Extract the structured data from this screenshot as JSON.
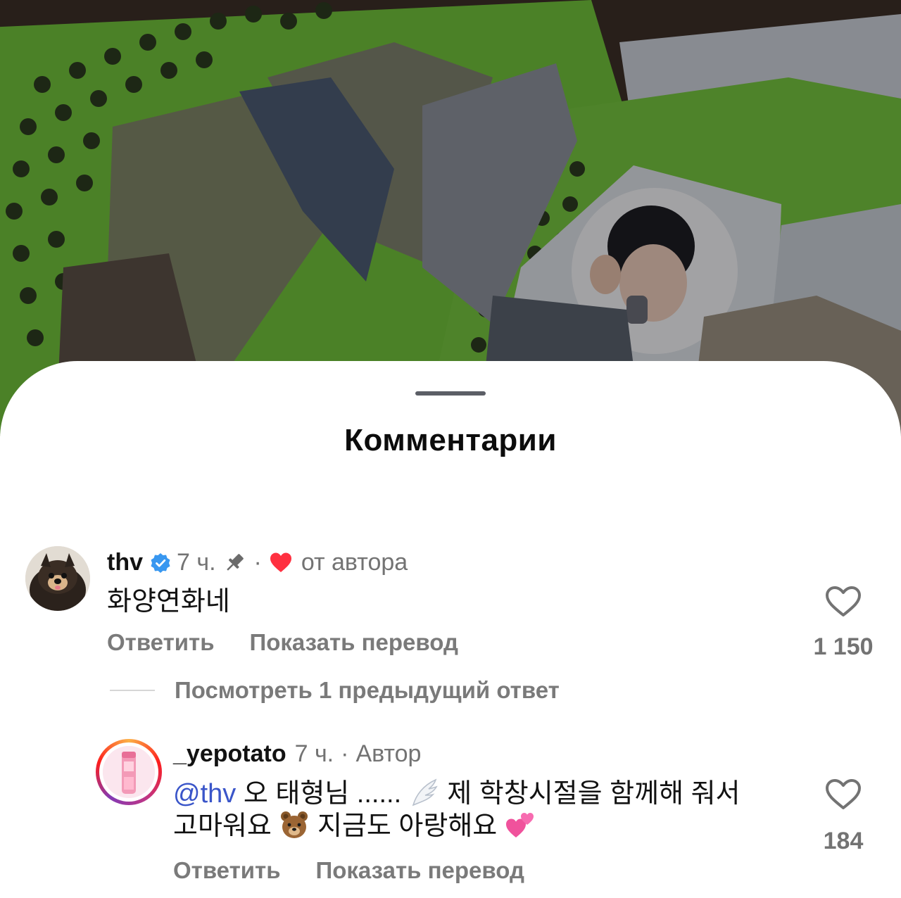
{
  "sheet": {
    "title": "Комментарии"
  },
  "comments": [
    {
      "username": "thv",
      "verified": true,
      "time": "7 ч.",
      "pinned": true,
      "separator": "·",
      "liked_by_author_label": "от автора",
      "text": "화양연화네",
      "reply_label": "Ответить",
      "translate_label": "Показать перевод",
      "like_count": "1 150",
      "icons": [
        "verified-badge-icon",
        "pin-icon",
        "red-heart-icon",
        "heart-outline-icon"
      ]
    },
    {
      "username": "_yepotato",
      "time": "7 ч.",
      "separator": "·",
      "author_label": "Автор",
      "mention": "@thv",
      "text_line1": "오 태형님 ......",
      "text_line1b": "제 학창시절을 함께해 줘서",
      "text_line2a": "고마워요",
      "text_line2b": "지금도 아랑해요",
      "reply_label": "Ответить",
      "translate_label": "Показать перевод",
      "like_count": "184",
      "icons": [
        "wing-emoji-icon",
        "bear-emoji-icon",
        "two-hearts-emoji-icon",
        "heart-outline-icon"
      ]
    }
  ],
  "replies_toggle": {
    "label": "Посмотреть 1 предыдущий ответ"
  },
  "colors": {
    "accent_link": "#3a55c9",
    "verified_blue": "#3897f0",
    "heart_red": "#ff3040",
    "muted_text": "#737373",
    "basket_green": "#6fbf3a"
  }
}
